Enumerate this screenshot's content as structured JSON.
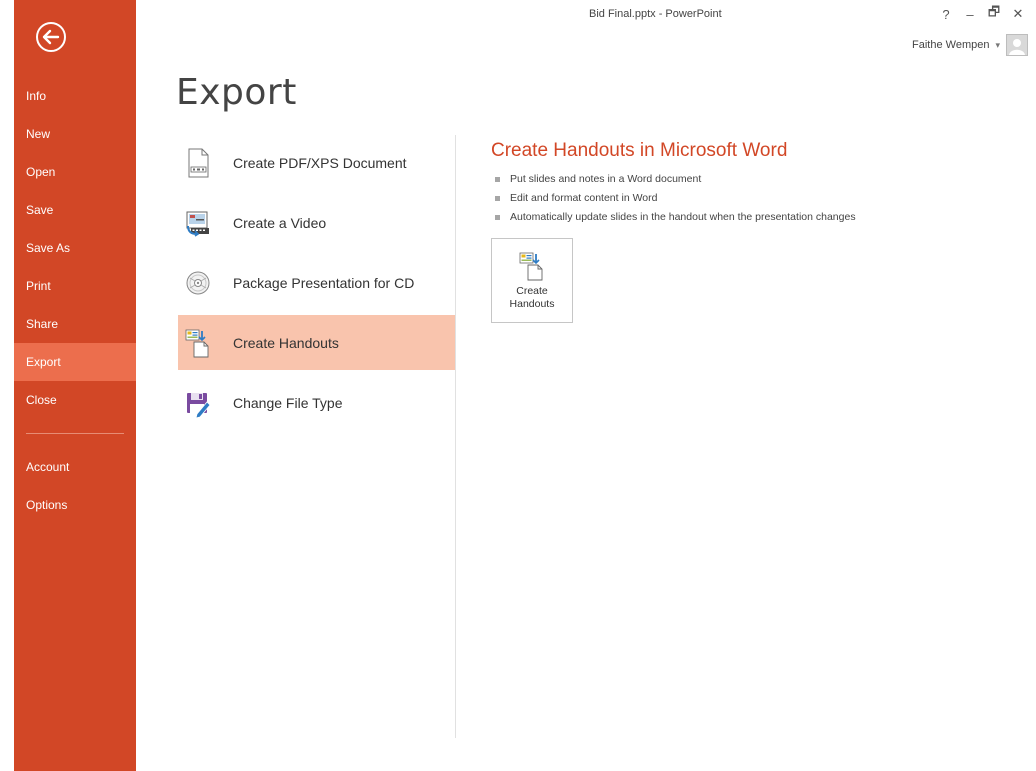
{
  "window": {
    "title": "Bid Final.pptx - PowerPoint",
    "help_label": "?",
    "minimize_label": "–",
    "restore_label": "🗗",
    "close_label": "✕",
    "user_name": "Faithe Wempen",
    "user_menu_caret": "▾"
  },
  "sidebar": {
    "items": [
      {
        "label": "Info"
      },
      {
        "label": "New"
      },
      {
        "label": "Open"
      },
      {
        "label": "Save"
      },
      {
        "label": "Save As"
      },
      {
        "label": "Print"
      },
      {
        "label": "Share"
      },
      {
        "label": "Export"
      },
      {
        "label": "Close"
      },
      {
        "label": "Account"
      },
      {
        "label": "Options"
      }
    ],
    "active": "Export"
  },
  "main": {
    "title": "Export",
    "options": [
      {
        "label": "Create PDF/XPS Document",
        "icon": "pdf-document-icon"
      },
      {
        "label": "Create a Video",
        "icon": "video-icon"
      },
      {
        "label": "Package Presentation for CD",
        "icon": "cd-icon"
      },
      {
        "label": "Create Handouts",
        "icon": "handouts-icon"
      },
      {
        "label": "Change File Type",
        "icon": "save-disk-icon"
      }
    ],
    "selected": "Create Handouts"
  },
  "detail": {
    "title": "Create Handouts in Microsoft Word",
    "bullets": [
      "Put slides and notes in a Word document",
      "Edit and format content in Word",
      "Automatically update slides in the handout when the presentation changes"
    ],
    "button_line1": "Create",
    "button_line2": "Handouts"
  },
  "colors": {
    "accent": "#d24726",
    "sidebar_active": "#ec6e4d",
    "selection": "#f9c4ad"
  }
}
